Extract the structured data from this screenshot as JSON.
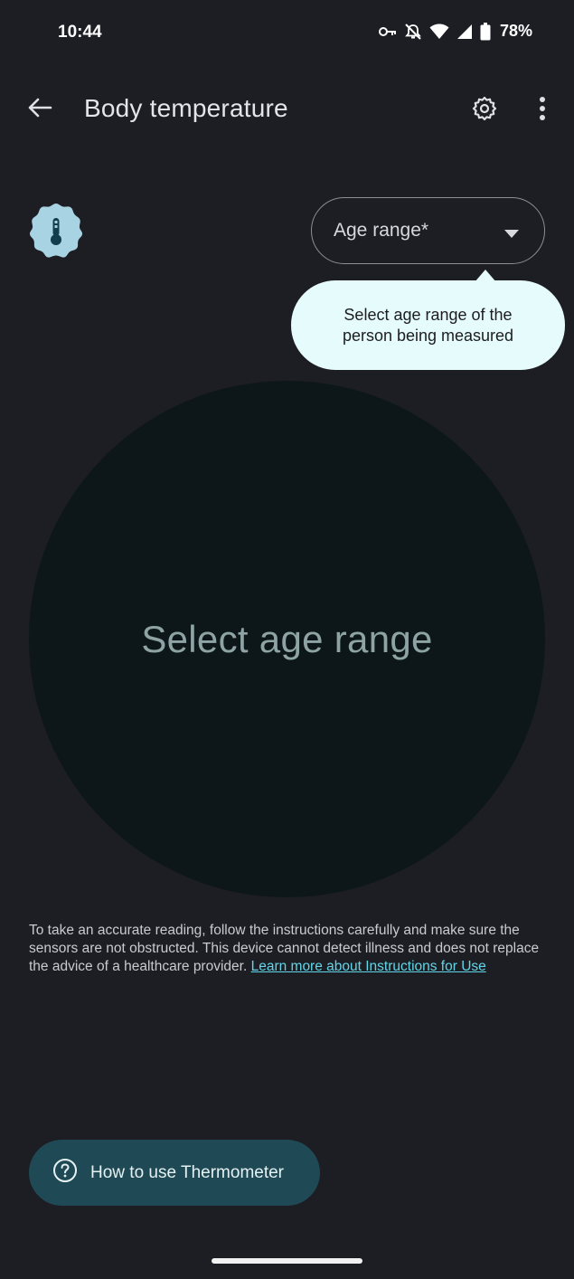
{
  "status_bar": {
    "time": "10:44",
    "battery_percent": "78%",
    "icons": [
      "vpn-key-icon",
      "sound-off-icon",
      "wifi-icon",
      "signal-icon",
      "battery-icon"
    ]
  },
  "app_bar": {
    "title": "Body temperature",
    "back_icon": "arrow-back-icon",
    "settings_icon": "gear-icon",
    "more_icon": "more-vert-icon"
  },
  "age_dropdown": {
    "label": "Age range*",
    "arrow_icon": "dropdown-arrow-icon"
  },
  "tooltip": {
    "text": "Select age range of the person being measured"
  },
  "reading_circle": {
    "text": "Select age range"
  },
  "disclaimer": {
    "text": "To take an accurate reading, follow the instructions carefully and make sure the sensors are not obstructed. This device cannot detect illness and does not replace the advice of a healthcare provider.",
    "link_text": "Learn more about Instructions for Use"
  },
  "help_button": {
    "label": "How to use Thermometer",
    "icon": "help-circle-icon"
  },
  "colors": {
    "background": "#1d1d24",
    "tooltip_bg": "#e6fbfb",
    "circle_bg": "#0d1719",
    "link": "#60d6e8",
    "button_bg": "#1f4a55",
    "badge_bg": "#a8d3e3"
  }
}
